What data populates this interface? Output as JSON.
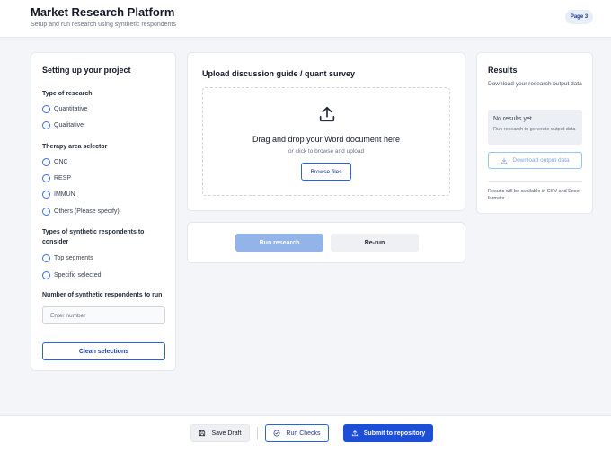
{
  "header": {
    "title": "Market Research Platform",
    "subtitle": "Setup and run research using synthetic respondents",
    "page_badge": "Page 3"
  },
  "setup": {
    "title": "Setting up your project",
    "research_type": {
      "label": "Type of research",
      "options": [
        "Quantitative",
        "Qualitative"
      ]
    },
    "therapy_area": {
      "label": "Therapy area selector",
      "options": [
        "ONC",
        "RESP",
        "IMMUN",
        "Others (Please specify)"
      ]
    },
    "respondent_types": {
      "label": "Types of synthetic respondents to consider",
      "options": [
        "Top segments",
        "Specific selected"
      ]
    },
    "respondent_count": {
      "label": "Number of synthetic respondents to run",
      "placeholder": "Enter number",
      "value": ""
    },
    "clean_label": "Clean selections"
  },
  "upload": {
    "title": "Upload discussion guide / quant survey",
    "drop_title": "Drag and drop your Word document here",
    "drop_subtitle": "or click to browse and upload",
    "browse_label": "Browse files"
  },
  "actions": {
    "run_label": "Run research",
    "rerun_label": "Re-run"
  },
  "results": {
    "title": "Results",
    "subtitle": "Download your research output data",
    "empty_title": "No results yet",
    "empty_subtitle": "Run research to generate output data",
    "download_label": "Download output data",
    "note": "Results will be available in CSV and Excel formats"
  },
  "footer": {
    "save_label": "Save Draft",
    "checks_label": "Run Checks",
    "submit_label": "Submit to repository"
  },
  "colors": {
    "accent": "#2563eb",
    "primary_button": "#1d4ed8",
    "disabled_button": "#93b4e8"
  }
}
